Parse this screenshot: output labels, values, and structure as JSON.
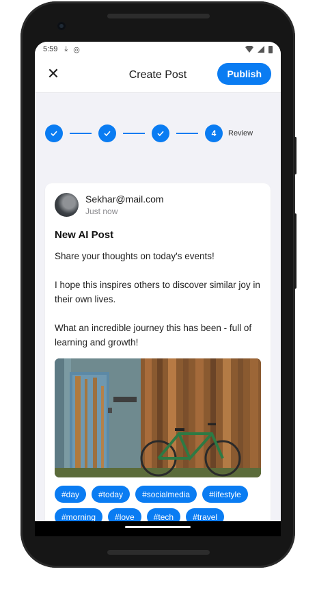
{
  "status_bar": {
    "time": "5:59",
    "icons": [
      "download-icon",
      "sync-icon",
      "wifi-icon",
      "signal-icon",
      "battery-icon"
    ]
  },
  "app_bar": {
    "title": "Create Post",
    "close_icon": "close-icon",
    "publish_label": "Publish"
  },
  "stepper": {
    "steps": [
      {
        "state": "done",
        "icon": "check-icon"
      },
      {
        "state": "done",
        "icon": "check-icon"
      },
      {
        "state": "done",
        "icon": "check-icon"
      },
      {
        "state": "current",
        "number": "4",
        "label": "Review"
      }
    ],
    "accent": "#0a7cf2"
  },
  "post": {
    "author": "Sekhar@mail.com",
    "time": "Just now",
    "title": "New AI Post",
    "paragraphs": [
      "Share your thoughts on today's events!",
      "I hope this inspires others to discover similar joy in their own lives.",
      "What an incredible journey this has been - full of learning and growth!"
    ],
    "image": "weathered-door-bicycle-photo",
    "tags": [
      "#day",
      "#today",
      "#socialmedia",
      "#lifestyle",
      "#morning",
      "#love",
      "#tech",
      "#travel"
    ]
  }
}
